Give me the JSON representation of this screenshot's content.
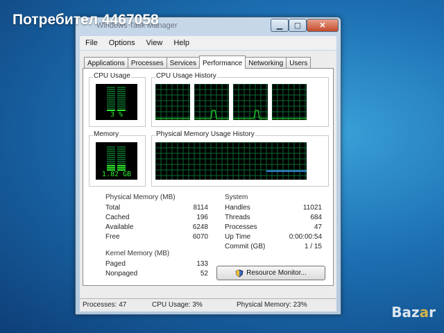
{
  "watermark": "Потребител 4467058",
  "brand": {
    "text": "Bazar",
    "accent": "#f6c23b"
  },
  "window": {
    "title": "Windows Task Manager"
  },
  "menu": [
    "File",
    "Options",
    "View",
    "Help"
  ],
  "tabs": [
    "Applications",
    "Processes",
    "Services",
    "Performance",
    "Networking",
    "Users"
  ],
  "active_tab": "Performance",
  "cpu": {
    "label": "CPU Usage",
    "value": "3 %",
    "history_label": "CPU Usage History",
    "percent": 3
  },
  "memory": {
    "label": "Memory",
    "value": "1.82 GB",
    "history_label": "Physical Memory Usage History",
    "percent": 23
  },
  "physical_memory": {
    "title": "Physical Memory (MB)",
    "rows": [
      {
        "label": "Total",
        "value": "8114"
      },
      {
        "label": "Cached",
        "value": "196"
      },
      {
        "label": "Available",
        "value": "6248"
      },
      {
        "label": "Free",
        "value": "6070"
      }
    ]
  },
  "kernel_memory": {
    "title": "Kernel Memory (MB)",
    "rows": [
      {
        "label": "Paged",
        "value": "133"
      },
      {
        "label": "Nonpaged",
        "value": "52"
      }
    ]
  },
  "system": {
    "title": "System",
    "rows": [
      {
        "label": "Handles",
        "value": "11021"
      },
      {
        "label": "Threads",
        "value": "684"
      },
      {
        "label": "Processes",
        "value": "47"
      },
      {
        "label": "Up Time",
        "value": "0:00:00:54"
      },
      {
        "label": "Commit (GB)",
        "value": "1 / 15"
      }
    ]
  },
  "resource_monitor_button": "Resource Monitor...",
  "status": {
    "processes": "Processes: 47",
    "cpu": "CPU Usage: 3%",
    "memory": "Physical Memory: 23%"
  },
  "colors": {
    "graph_bg": "#000000",
    "grid": "#0a6b34",
    "meter": "#2cf02c",
    "memory_line": "#3a8cf0"
  }
}
